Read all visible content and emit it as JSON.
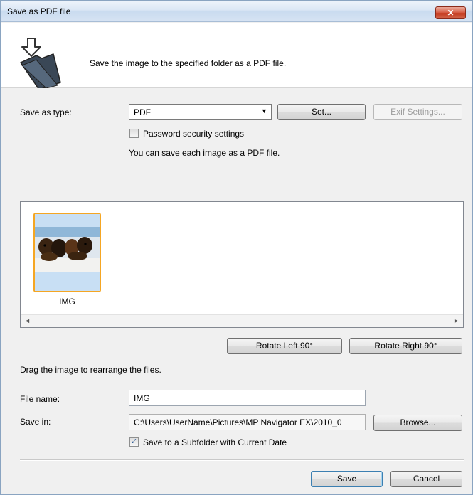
{
  "window": {
    "title": "Save as PDF file",
    "close_label": "✕"
  },
  "header": {
    "description": "Save the image to the specified folder as a PDF file."
  },
  "type_section": {
    "save_as_type_label": "Save as type:",
    "save_as_type_value": "PDF",
    "set_button": "Set...",
    "exif_button": "Exif Settings...",
    "password_checkbox_label": "Password security settings",
    "password_checked": false,
    "info_text": "You can save each image as a PDF file."
  },
  "image_list": {
    "items": [
      {
        "name": "IMG",
        "selected": true
      }
    ],
    "rotate_left_button": "Rotate Left 90°",
    "rotate_right_button": "Rotate Right 90°",
    "drag_hint": "Drag the image to rearrange the files."
  },
  "file_section": {
    "file_name_label": "File name:",
    "file_name_value": "IMG",
    "save_in_label": "Save in:",
    "save_in_value": "C:\\Users\\UserName\\Pictures\\MP Navigator EX\\2010_0",
    "browse_button": "Browse...",
    "subfolder_checkbox_label": "Save to a Subfolder with Current Date",
    "subfolder_checked": true
  },
  "footer": {
    "save_button": "Save",
    "cancel_button": "Cancel"
  },
  "colors": {
    "selection_border": "#f5a623",
    "thumbnail_bg": "#c8dff4",
    "titlebar": "#dbe7f5"
  }
}
